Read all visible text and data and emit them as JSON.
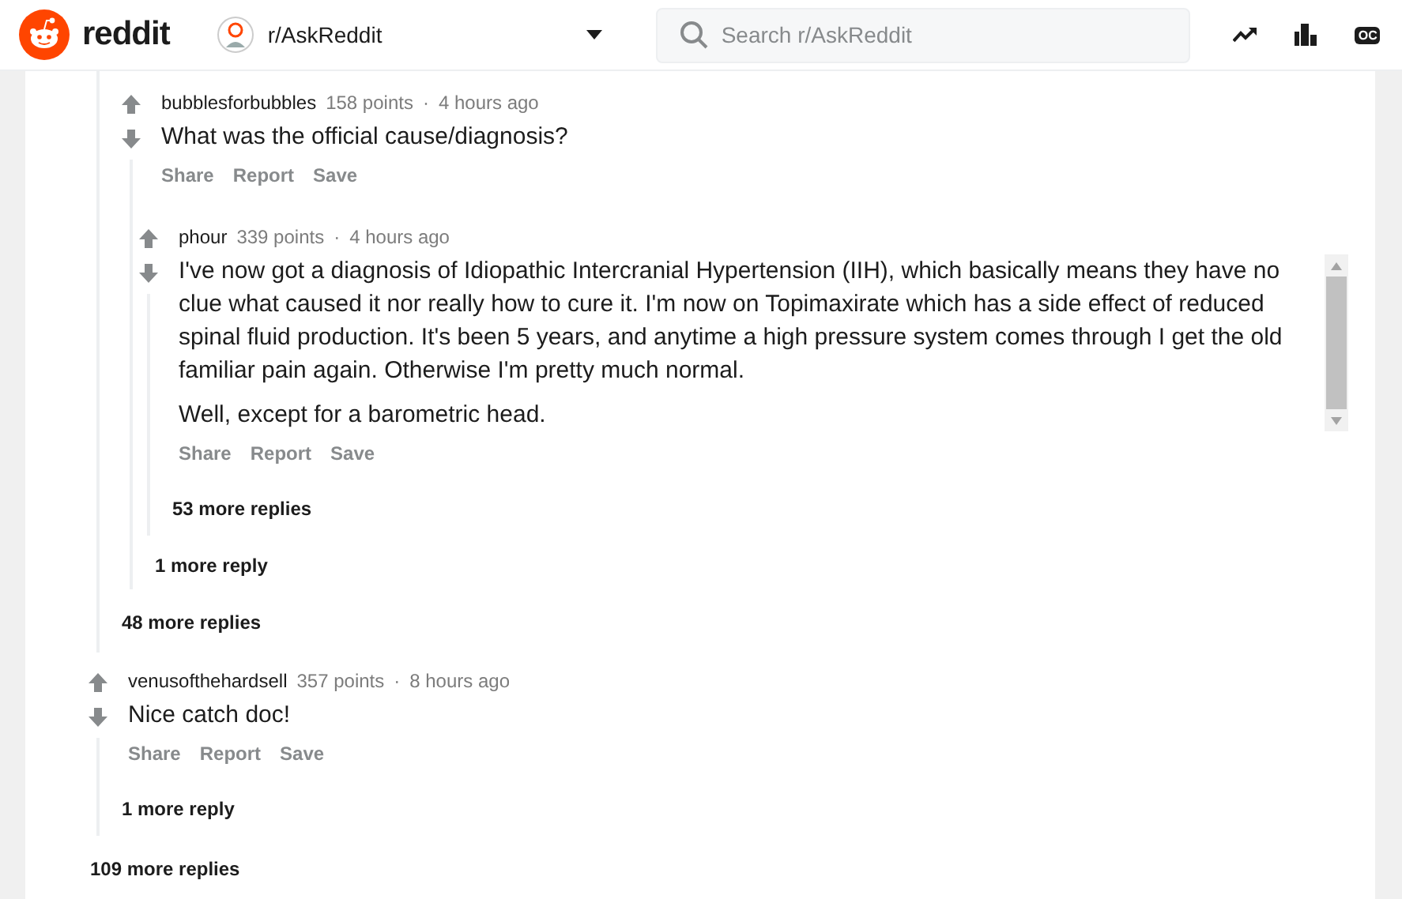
{
  "header": {
    "logo_text": "reddit",
    "subreddit": "r/AskReddit",
    "search": {
      "placeholder": "Search r/AskReddit"
    },
    "badge": "OC"
  },
  "thread": {
    "partial_comment": {
      "replies": [
        {
          "author": "bubblesforbubbles",
          "points": "158 points",
          "separator": "·",
          "time": "4 hours ago",
          "body": [
            "What was the official cause/diagnosis?"
          ],
          "scrollable": false,
          "actions": [
            "Share",
            "Report",
            "Save"
          ],
          "replies": [
            {
              "author": "phour",
              "points": "339 points",
              "separator": "·",
              "time": "4 hours ago",
              "body": [
                "I've now got a diagnosis of Idiopathic Intercranial Hypertension (IIH), which basically means they have no clue what caused it nor really how to cure it. I'm now on Topimaxirate which has a side effect of reduced spinal fluid production. It's been 5 years, and anytime a high pressure system comes through I get the old familiar pain again. Otherwise I'm pretty much normal.",
                "Well, except for a barometric head."
              ],
              "scrollable": true,
              "actions": [
                "Share",
                "Report",
                "Save"
              ],
              "more": "53 more replies"
            }
          ],
          "more": "1 more reply"
        }
      ],
      "more": "48 more replies"
    },
    "comments": [
      {
        "author": "venusofthehardsell",
        "points": "357 points",
        "separator": "·",
        "time": "8 hours ago",
        "body": [
          "Nice catch doc!"
        ],
        "scrollable": false,
        "actions": [
          "Share",
          "Report",
          "Save"
        ],
        "more": "1 more reply"
      }
    ],
    "more": "109 more replies"
  }
}
